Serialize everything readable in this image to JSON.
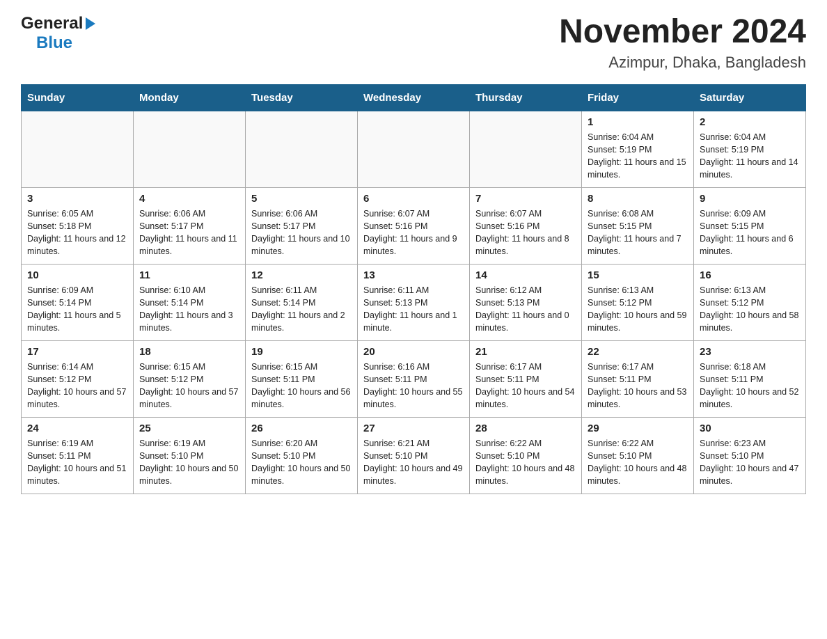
{
  "header": {
    "logo": {
      "general": "General",
      "blue": "Blue"
    },
    "title": "November 2024",
    "location": "Azimpur, Dhaka, Bangladesh"
  },
  "calendar": {
    "days_of_week": [
      "Sunday",
      "Monday",
      "Tuesday",
      "Wednesday",
      "Thursday",
      "Friday",
      "Saturday"
    ],
    "weeks": [
      [
        {
          "day": "",
          "info": "",
          "empty": true
        },
        {
          "day": "",
          "info": "",
          "empty": true
        },
        {
          "day": "",
          "info": "",
          "empty": true
        },
        {
          "day": "",
          "info": "",
          "empty": true
        },
        {
          "day": "",
          "info": "",
          "empty": true
        },
        {
          "day": "1",
          "info": "Sunrise: 6:04 AM\nSunset: 5:19 PM\nDaylight: 11 hours and 15 minutes."
        },
        {
          "day": "2",
          "info": "Sunrise: 6:04 AM\nSunset: 5:19 PM\nDaylight: 11 hours and 14 minutes."
        }
      ],
      [
        {
          "day": "3",
          "info": "Sunrise: 6:05 AM\nSunset: 5:18 PM\nDaylight: 11 hours and 12 minutes."
        },
        {
          "day": "4",
          "info": "Sunrise: 6:06 AM\nSunset: 5:17 PM\nDaylight: 11 hours and 11 minutes."
        },
        {
          "day": "5",
          "info": "Sunrise: 6:06 AM\nSunset: 5:17 PM\nDaylight: 11 hours and 10 minutes."
        },
        {
          "day": "6",
          "info": "Sunrise: 6:07 AM\nSunset: 5:16 PM\nDaylight: 11 hours and 9 minutes."
        },
        {
          "day": "7",
          "info": "Sunrise: 6:07 AM\nSunset: 5:16 PM\nDaylight: 11 hours and 8 minutes."
        },
        {
          "day": "8",
          "info": "Sunrise: 6:08 AM\nSunset: 5:15 PM\nDaylight: 11 hours and 7 minutes."
        },
        {
          "day": "9",
          "info": "Sunrise: 6:09 AM\nSunset: 5:15 PM\nDaylight: 11 hours and 6 minutes."
        }
      ],
      [
        {
          "day": "10",
          "info": "Sunrise: 6:09 AM\nSunset: 5:14 PM\nDaylight: 11 hours and 5 minutes."
        },
        {
          "day": "11",
          "info": "Sunrise: 6:10 AM\nSunset: 5:14 PM\nDaylight: 11 hours and 3 minutes."
        },
        {
          "day": "12",
          "info": "Sunrise: 6:11 AM\nSunset: 5:14 PM\nDaylight: 11 hours and 2 minutes."
        },
        {
          "day": "13",
          "info": "Sunrise: 6:11 AM\nSunset: 5:13 PM\nDaylight: 11 hours and 1 minute."
        },
        {
          "day": "14",
          "info": "Sunrise: 6:12 AM\nSunset: 5:13 PM\nDaylight: 11 hours and 0 minutes."
        },
        {
          "day": "15",
          "info": "Sunrise: 6:13 AM\nSunset: 5:12 PM\nDaylight: 10 hours and 59 minutes."
        },
        {
          "day": "16",
          "info": "Sunrise: 6:13 AM\nSunset: 5:12 PM\nDaylight: 10 hours and 58 minutes."
        }
      ],
      [
        {
          "day": "17",
          "info": "Sunrise: 6:14 AM\nSunset: 5:12 PM\nDaylight: 10 hours and 57 minutes."
        },
        {
          "day": "18",
          "info": "Sunrise: 6:15 AM\nSunset: 5:12 PM\nDaylight: 10 hours and 57 minutes."
        },
        {
          "day": "19",
          "info": "Sunrise: 6:15 AM\nSunset: 5:11 PM\nDaylight: 10 hours and 56 minutes."
        },
        {
          "day": "20",
          "info": "Sunrise: 6:16 AM\nSunset: 5:11 PM\nDaylight: 10 hours and 55 minutes."
        },
        {
          "day": "21",
          "info": "Sunrise: 6:17 AM\nSunset: 5:11 PM\nDaylight: 10 hours and 54 minutes."
        },
        {
          "day": "22",
          "info": "Sunrise: 6:17 AM\nSunset: 5:11 PM\nDaylight: 10 hours and 53 minutes."
        },
        {
          "day": "23",
          "info": "Sunrise: 6:18 AM\nSunset: 5:11 PM\nDaylight: 10 hours and 52 minutes."
        }
      ],
      [
        {
          "day": "24",
          "info": "Sunrise: 6:19 AM\nSunset: 5:11 PM\nDaylight: 10 hours and 51 minutes."
        },
        {
          "day": "25",
          "info": "Sunrise: 6:19 AM\nSunset: 5:10 PM\nDaylight: 10 hours and 50 minutes."
        },
        {
          "day": "26",
          "info": "Sunrise: 6:20 AM\nSunset: 5:10 PM\nDaylight: 10 hours and 50 minutes."
        },
        {
          "day": "27",
          "info": "Sunrise: 6:21 AM\nSunset: 5:10 PM\nDaylight: 10 hours and 49 minutes."
        },
        {
          "day": "28",
          "info": "Sunrise: 6:22 AM\nSunset: 5:10 PM\nDaylight: 10 hours and 48 minutes."
        },
        {
          "day": "29",
          "info": "Sunrise: 6:22 AM\nSunset: 5:10 PM\nDaylight: 10 hours and 48 minutes."
        },
        {
          "day": "30",
          "info": "Sunrise: 6:23 AM\nSunset: 5:10 PM\nDaylight: 10 hours and 47 minutes."
        }
      ]
    ]
  }
}
